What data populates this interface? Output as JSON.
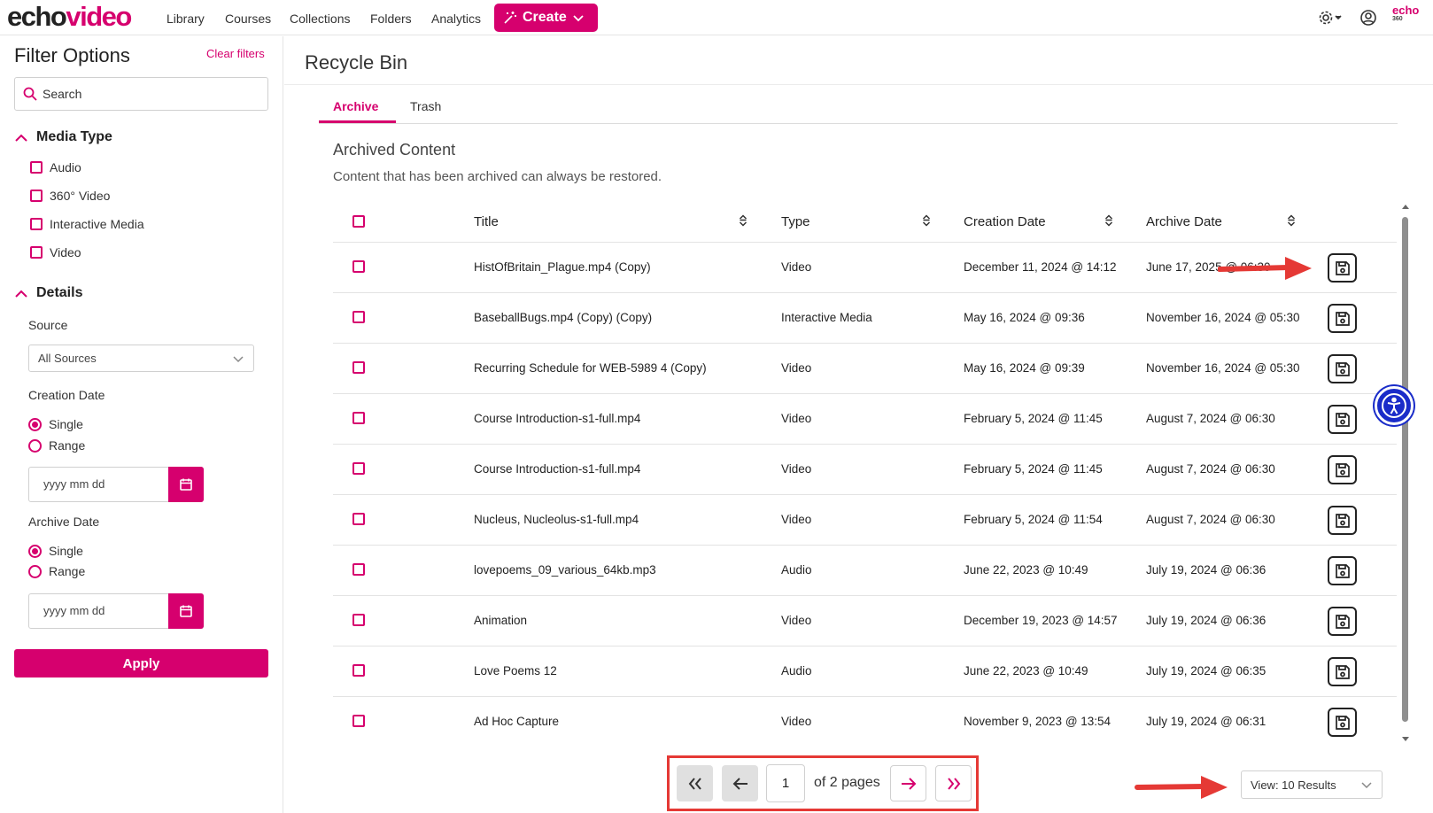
{
  "brand": {
    "logo_part1": "echo",
    "logo_part2": "video",
    "mini_logo_top": "echo",
    "mini_logo_bottom": "360"
  },
  "nav": {
    "items": [
      "Library",
      "Courses",
      "Collections",
      "Folders",
      "Analytics"
    ],
    "create_label": "Create"
  },
  "sidebar": {
    "title": "Filter Options",
    "clear_label": "Clear filters",
    "search_placeholder": "Search",
    "media_type": {
      "heading": "Media Type",
      "options": [
        "Audio",
        "360° Video",
        "Interactive Media",
        "Video"
      ]
    },
    "details": {
      "heading": "Details",
      "source_label": "Source",
      "source_value": "All Sources",
      "creation_label": "Creation Date",
      "creation_single": "Single",
      "creation_range": "Range",
      "creation_placeholder": "yyyy mm dd",
      "archive_label": "Archive Date",
      "archive_single": "Single",
      "archive_range": "Range",
      "archive_placeholder": "yyyy mm dd"
    },
    "apply_label": "Apply"
  },
  "main": {
    "title": "Recycle Bin",
    "tabs": [
      {
        "label": "Archive",
        "active": true
      },
      {
        "label": "Trash",
        "active": false
      }
    ],
    "section_title": "Archived Content",
    "section_desc": "Content that has been archived can always be restored.",
    "columns": [
      "Title",
      "Type",
      "Creation Date",
      "Archive Date"
    ],
    "rows": [
      {
        "title": "HistOfBritain_Plague.mp4 (Copy)",
        "type": "Video",
        "created": "December 11, 2024 @ 14:12",
        "archived": "June 17, 2025 @ 06:30"
      },
      {
        "title": "BaseballBugs.mp4 (Copy) (Copy)",
        "type": "Interactive Media",
        "created": "May 16, 2024 @ 09:36",
        "archived": "November 16, 2024 @ 05:30"
      },
      {
        "title": "Recurring Schedule for WEB-5989 4 (Copy)",
        "type": "Video",
        "created": "May 16, 2024 @ 09:39",
        "archived": "November 16, 2024 @ 05:30"
      },
      {
        "title": "Course Introduction-s1-full.mp4",
        "type": "Video",
        "created": "February 5, 2024 @ 11:45",
        "archived": "August 7, 2024 @ 06:30"
      },
      {
        "title": "Course Introduction-s1-full.mp4",
        "type": "Video",
        "created": "February 5, 2024 @ 11:45",
        "archived": "August 7, 2024 @ 06:30"
      },
      {
        "title": "Nucleus, Nucleolus-s1-full.mp4",
        "type": "Video",
        "created": "February 5, 2024 @ 11:54",
        "archived": "August 7, 2024 @ 06:30"
      },
      {
        "title": "lovepoems_09_various_64kb.mp3",
        "type": "Audio",
        "created": "June 22, 2023 @ 10:49",
        "archived": "July 19, 2024 @ 06:36"
      },
      {
        "title": "Animation",
        "type": "Video",
        "created": "December 19, 2023 @ 14:57",
        "archived": "July 19, 2024 @ 06:36"
      },
      {
        "title": "Love Poems 12",
        "type": "Audio",
        "created": "June 22, 2023 @ 10:49",
        "archived": "July 19, 2024 @ 06:35"
      },
      {
        "title": "Ad Hoc Capture",
        "type": "Video",
        "created": "November 9, 2023 @ 13:54",
        "archived": "July 19, 2024 @ 06:31"
      }
    ]
  },
  "pagination": {
    "current_page": "1",
    "of_label": "of 2 pages",
    "view_label": "View: 10 Results"
  },
  "colors": {
    "accent": "#d6006e",
    "annotation_red": "#e53935",
    "a11y_blue": "#1a2cc9"
  }
}
